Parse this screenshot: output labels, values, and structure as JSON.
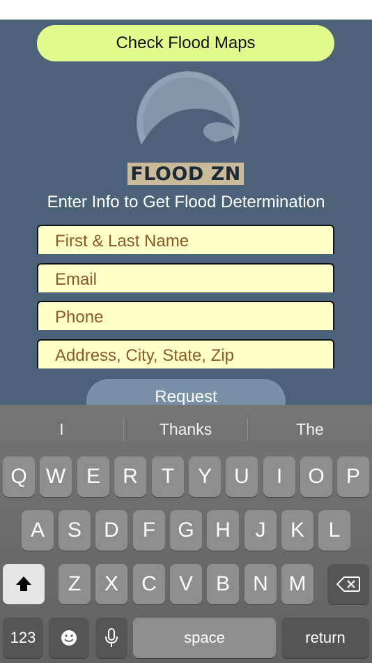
{
  "header": {
    "maps_button_label": "Check Flood Maps"
  },
  "logo": {
    "text": "FLOOD ZN"
  },
  "form": {
    "subtitle": "Enter Info to Get Flood Determination",
    "name_placeholder": "First & Last Name",
    "email_placeholder": "Email",
    "phone_placeholder": "Phone",
    "address_placeholder": "Address, City, State, Zip",
    "submit_label": "Request"
  },
  "keyboard": {
    "suggestions": [
      "I",
      "Thanks",
      "The"
    ],
    "row1": [
      "Q",
      "W",
      "E",
      "R",
      "T",
      "Y",
      "U",
      "I",
      "O",
      "P"
    ],
    "row2": [
      "A",
      "S",
      "D",
      "F",
      "G",
      "H",
      "J",
      "K",
      "L"
    ],
    "row3": [
      "Z",
      "X",
      "C",
      "V",
      "B",
      "N",
      "M"
    ],
    "numbers_label": "123",
    "space_label": "space",
    "return_label": "return"
  },
  "icons": {
    "shift": "shift-icon",
    "delete": "backspace-icon",
    "emoji": "emoji-icon",
    "mic": "microphone-icon"
  },
  "colors": {
    "app_background": "#4c6278",
    "accent_button": "#e3fa8c",
    "field_background": "#ffffc8",
    "placeholder_text": "#8b5a2b"
  }
}
